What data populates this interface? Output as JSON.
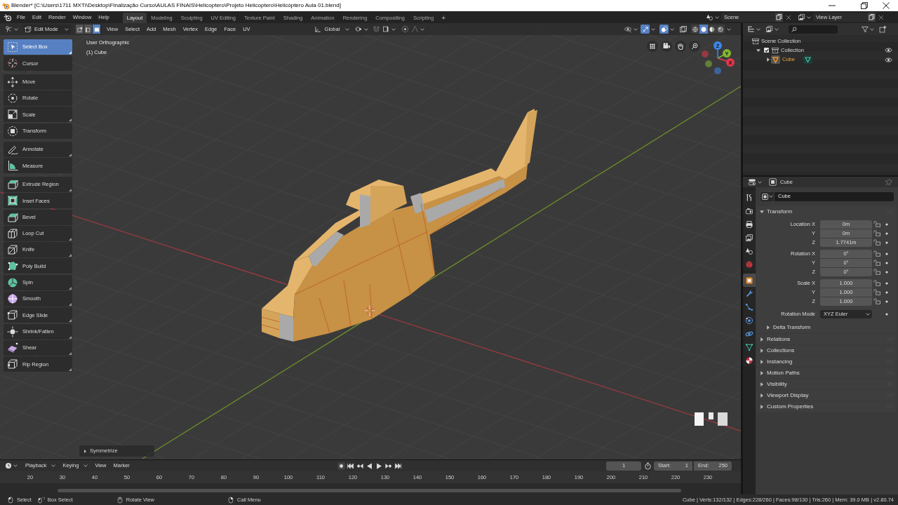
{
  "title_bar": {
    "title": "Blender* [C:\\Users\\1711 MXTI\\Desktop\\Finalização Curso\\AULAS FINAIS\\Helicoptero\\Projeto Helicoptero\\Helicóptero Aula 01.blend]"
  },
  "top_bar": {
    "menus": [
      "File",
      "Edit",
      "Render",
      "Window",
      "Help"
    ],
    "workspaces": [
      {
        "label": "Layout",
        "selected": true
      },
      {
        "label": "Modeling",
        "selected": false
      },
      {
        "label": "Sculpting",
        "selected": false
      },
      {
        "label": "UV Editing",
        "selected": false
      },
      {
        "label": "Texture Paint",
        "selected": false
      },
      {
        "label": "Shading",
        "selected": false
      },
      {
        "label": "Animation",
        "selected": false
      },
      {
        "label": "Rendering",
        "selected": false
      },
      {
        "label": "Compositing",
        "selected": false
      },
      {
        "label": "Scripting",
        "selected": false
      }
    ],
    "add_workspace": "+",
    "scene": "Scene",
    "view_layer": "View Layer"
  },
  "viewport_header": {
    "mode": "Edit Mode",
    "select_modes": [
      {
        "kind": "vertex",
        "selected": false
      },
      {
        "kind": "edge",
        "selected": false
      },
      {
        "kind": "face",
        "selected": true
      }
    ],
    "menus": [
      "View",
      "Select",
      "Add",
      "Mesh",
      "Vertex",
      "Edge",
      "Face",
      "UV"
    ],
    "orientation": "Global",
    "gizmos_on": true,
    "overlays_on": true,
    "shading_modes": [
      {
        "kind": "wireframe",
        "selected": false
      },
      {
        "kind": "solid",
        "selected": true
      },
      {
        "kind": "material",
        "selected": false
      },
      {
        "kind": "rendered",
        "selected": false
      }
    ]
  },
  "toolbar": {
    "groups": [
      {
        "tools": [
          {
            "kind": "select_box",
            "label": "Select Box",
            "selected": true,
            "has_variants": true
          },
          {
            "kind": "cursor",
            "label": "Cursor",
            "selected": false,
            "has_variants": false
          }
        ]
      },
      {
        "tools": [
          {
            "kind": "move",
            "label": "Move",
            "selected": false,
            "has_variants": false
          },
          {
            "kind": "rotate",
            "label": "Rotate",
            "selected": false,
            "has_variants": false
          },
          {
            "kind": "scale",
            "label": "Scale",
            "selected": false,
            "has_variants": true
          },
          {
            "kind": "transform",
            "label": "Transform",
            "selected": false,
            "has_variants": false
          }
        ]
      },
      {
        "tools": [
          {
            "kind": "annotate",
            "label": "Annotate",
            "selected": false,
            "has_variants": true
          },
          {
            "kind": "measure",
            "label": "Measure",
            "selected": false,
            "has_variants": false
          }
        ]
      },
      {
        "tools": [
          {
            "kind": "extrude_region",
            "label": "Extrude Region",
            "selected": false,
            "has_variants": true
          },
          {
            "kind": "inset_faces",
            "label": "Inset Faces",
            "selected": false,
            "has_variants": false
          },
          {
            "kind": "bevel",
            "label": "Bevel",
            "selected": false,
            "has_variants": false
          },
          {
            "kind": "loop_cut",
            "label": "Loop Cut",
            "selected": false,
            "has_variants": true
          },
          {
            "kind": "knife",
            "label": "Knife",
            "selected": false,
            "has_variants": true
          },
          {
            "kind": "poly_build",
            "label": "Poly Build",
            "selected": false,
            "has_variants": false
          },
          {
            "kind": "spin",
            "label": "Spin",
            "selected": false,
            "has_variants": true
          },
          {
            "kind": "smooth",
            "label": "Smooth",
            "selected": false,
            "has_variants": true
          },
          {
            "kind": "edge_slide",
            "label": "Edge Slide",
            "selected": false,
            "has_variants": true
          },
          {
            "kind": "shrink_fatten",
            "label": "Shrink/Fatten",
            "selected": false,
            "has_variants": true
          },
          {
            "kind": "shear",
            "label": "Shear",
            "selected": false,
            "has_variants": true
          },
          {
            "kind": "rip_region",
            "label": "Rip Region",
            "selected": false,
            "has_variants": true
          }
        ]
      }
    ]
  },
  "viewport": {
    "view_name": "User Orthographic",
    "object_label": "(1) Cube",
    "axes": [
      {
        "label": "X",
        "color": "#e0384d"
      },
      {
        "label": "Y",
        "color": "#82b634"
      },
      {
        "label": "Z",
        "color": "#3b86e6"
      }
    ],
    "last_operator": "Symmetrize"
  },
  "outliner": {
    "tree": [
      {
        "kind": "scene_collection",
        "label": "Scene Collection",
        "selected": false,
        "children": [
          {
            "kind": "collection",
            "label": "Collection",
            "selected": false,
            "checked": true,
            "expanded": true,
            "visible": true,
            "children": [
              {
                "kind": "mesh_object",
                "label": "Cube",
                "selected": true,
                "expanded": false,
                "visible": true
              }
            ]
          }
        ]
      }
    ]
  },
  "properties": {
    "context": "Cube",
    "object_name": "Cube",
    "tab_groups": [
      {
        "tabs": [
          {
            "kind": "tool",
            "selected": false
          },
          {
            "kind": "render",
            "selected": false
          },
          {
            "kind": "output",
            "selected": false
          },
          {
            "kind": "view_layer",
            "selected": false
          },
          {
            "kind": "scene",
            "selected": false
          },
          {
            "kind": "world",
            "selected": false
          }
        ]
      },
      {
        "tabs": [
          {
            "kind": "object",
            "selected": true
          },
          {
            "kind": "modifiers",
            "selected": false
          },
          {
            "kind": "particles",
            "selected": false
          },
          {
            "kind": "physics",
            "selected": false
          },
          {
            "kind": "constraints",
            "selected": false
          },
          {
            "kind": "data",
            "selected": false
          },
          {
            "kind": "material",
            "selected": false
          }
        ]
      }
    ],
    "panels": [
      {
        "title": "Transform",
        "expanded": true,
        "groups": [
          {
            "kind": "vector",
            "rows": [
              {
                "label": "Location X",
                "value": "0m"
              },
              {
                "label": "Y",
                "value": "0m"
              },
              {
                "label": "Z",
                "value": "1.7741m"
              }
            ]
          },
          {
            "kind": "vector",
            "rows": [
              {
                "label": "Rotation X",
                "value": "0°"
              },
              {
                "label": "Y",
                "value": "0°"
              },
              {
                "label": "Z",
                "value": "0°"
              }
            ]
          },
          {
            "kind": "vector",
            "rows": [
              {
                "label": "Scale X",
                "value": "1.000"
              },
              {
                "label": "Y",
                "value": "1.000"
              },
              {
                "label": "Z",
                "value": "1.000"
              }
            ]
          },
          {
            "kind": "dropdown",
            "rows": [
              {
                "label": "Rotation Mode",
                "value": "XYZ Euler"
              }
            ]
          }
        ],
        "subpanels": [
          {
            "title": "Delta Transform",
            "expanded": false
          }
        ]
      },
      {
        "title": "Relations",
        "expanded": false
      },
      {
        "title": "Collections",
        "expanded": false
      },
      {
        "title": "Instancing",
        "expanded": false
      },
      {
        "title": "Motion Paths",
        "expanded": false
      },
      {
        "title": "Visibility",
        "expanded": false
      },
      {
        "title": "Viewport Display",
        "expanded": false
      },
      {
        "title": "Custom Properties",
        "expanded": false
      }
    ]
  },
  "timeline": {
    "menus": [
      {
        "kind": "dropdown",
        "label": "Playback"
      },
      {
        "kind": "dropdown",
        "label": "Keying"
      },
      {
        "kind": "menu",
        "label": "View"
      },
      {
        "kind": "menu",
        "label": "Marker"
      }
    ],
    "current_frame": "1",
    "start_label": "Start:",
    "start": "1",
    "end_label": "End:",
    "end": "250",
    "ruler": [
      "20",
      "30",
      "40",
      "50",
      "60",
      "70",
      "80",
      "90",
      "100",
      "110",
      "120",
      "130",
      "140",
      "150",
      "160",
      "170",
      "180",
      "190",
      "200",
      "210",
      "220",
      "230"
    ]
  },
  "status_bar": {
    "hints": [
      {
        "kind": "left_click",
        "label": "Select"
      },
      {
        "kind": "left_drag",
        "label": "Box Select"
      },
      {
        "kind": "middle_click",
        "label": "Rotate View"
      },
      {
        "kind": "right_click",
        "label": "Call Menu"
      }
    ],
    "stats": "Cube | Verts:132/132 | Edges:228/260 | Faces:98/130 | Tris:260 | Mem: 39.0 MB | v2.80.74"
  }
}
